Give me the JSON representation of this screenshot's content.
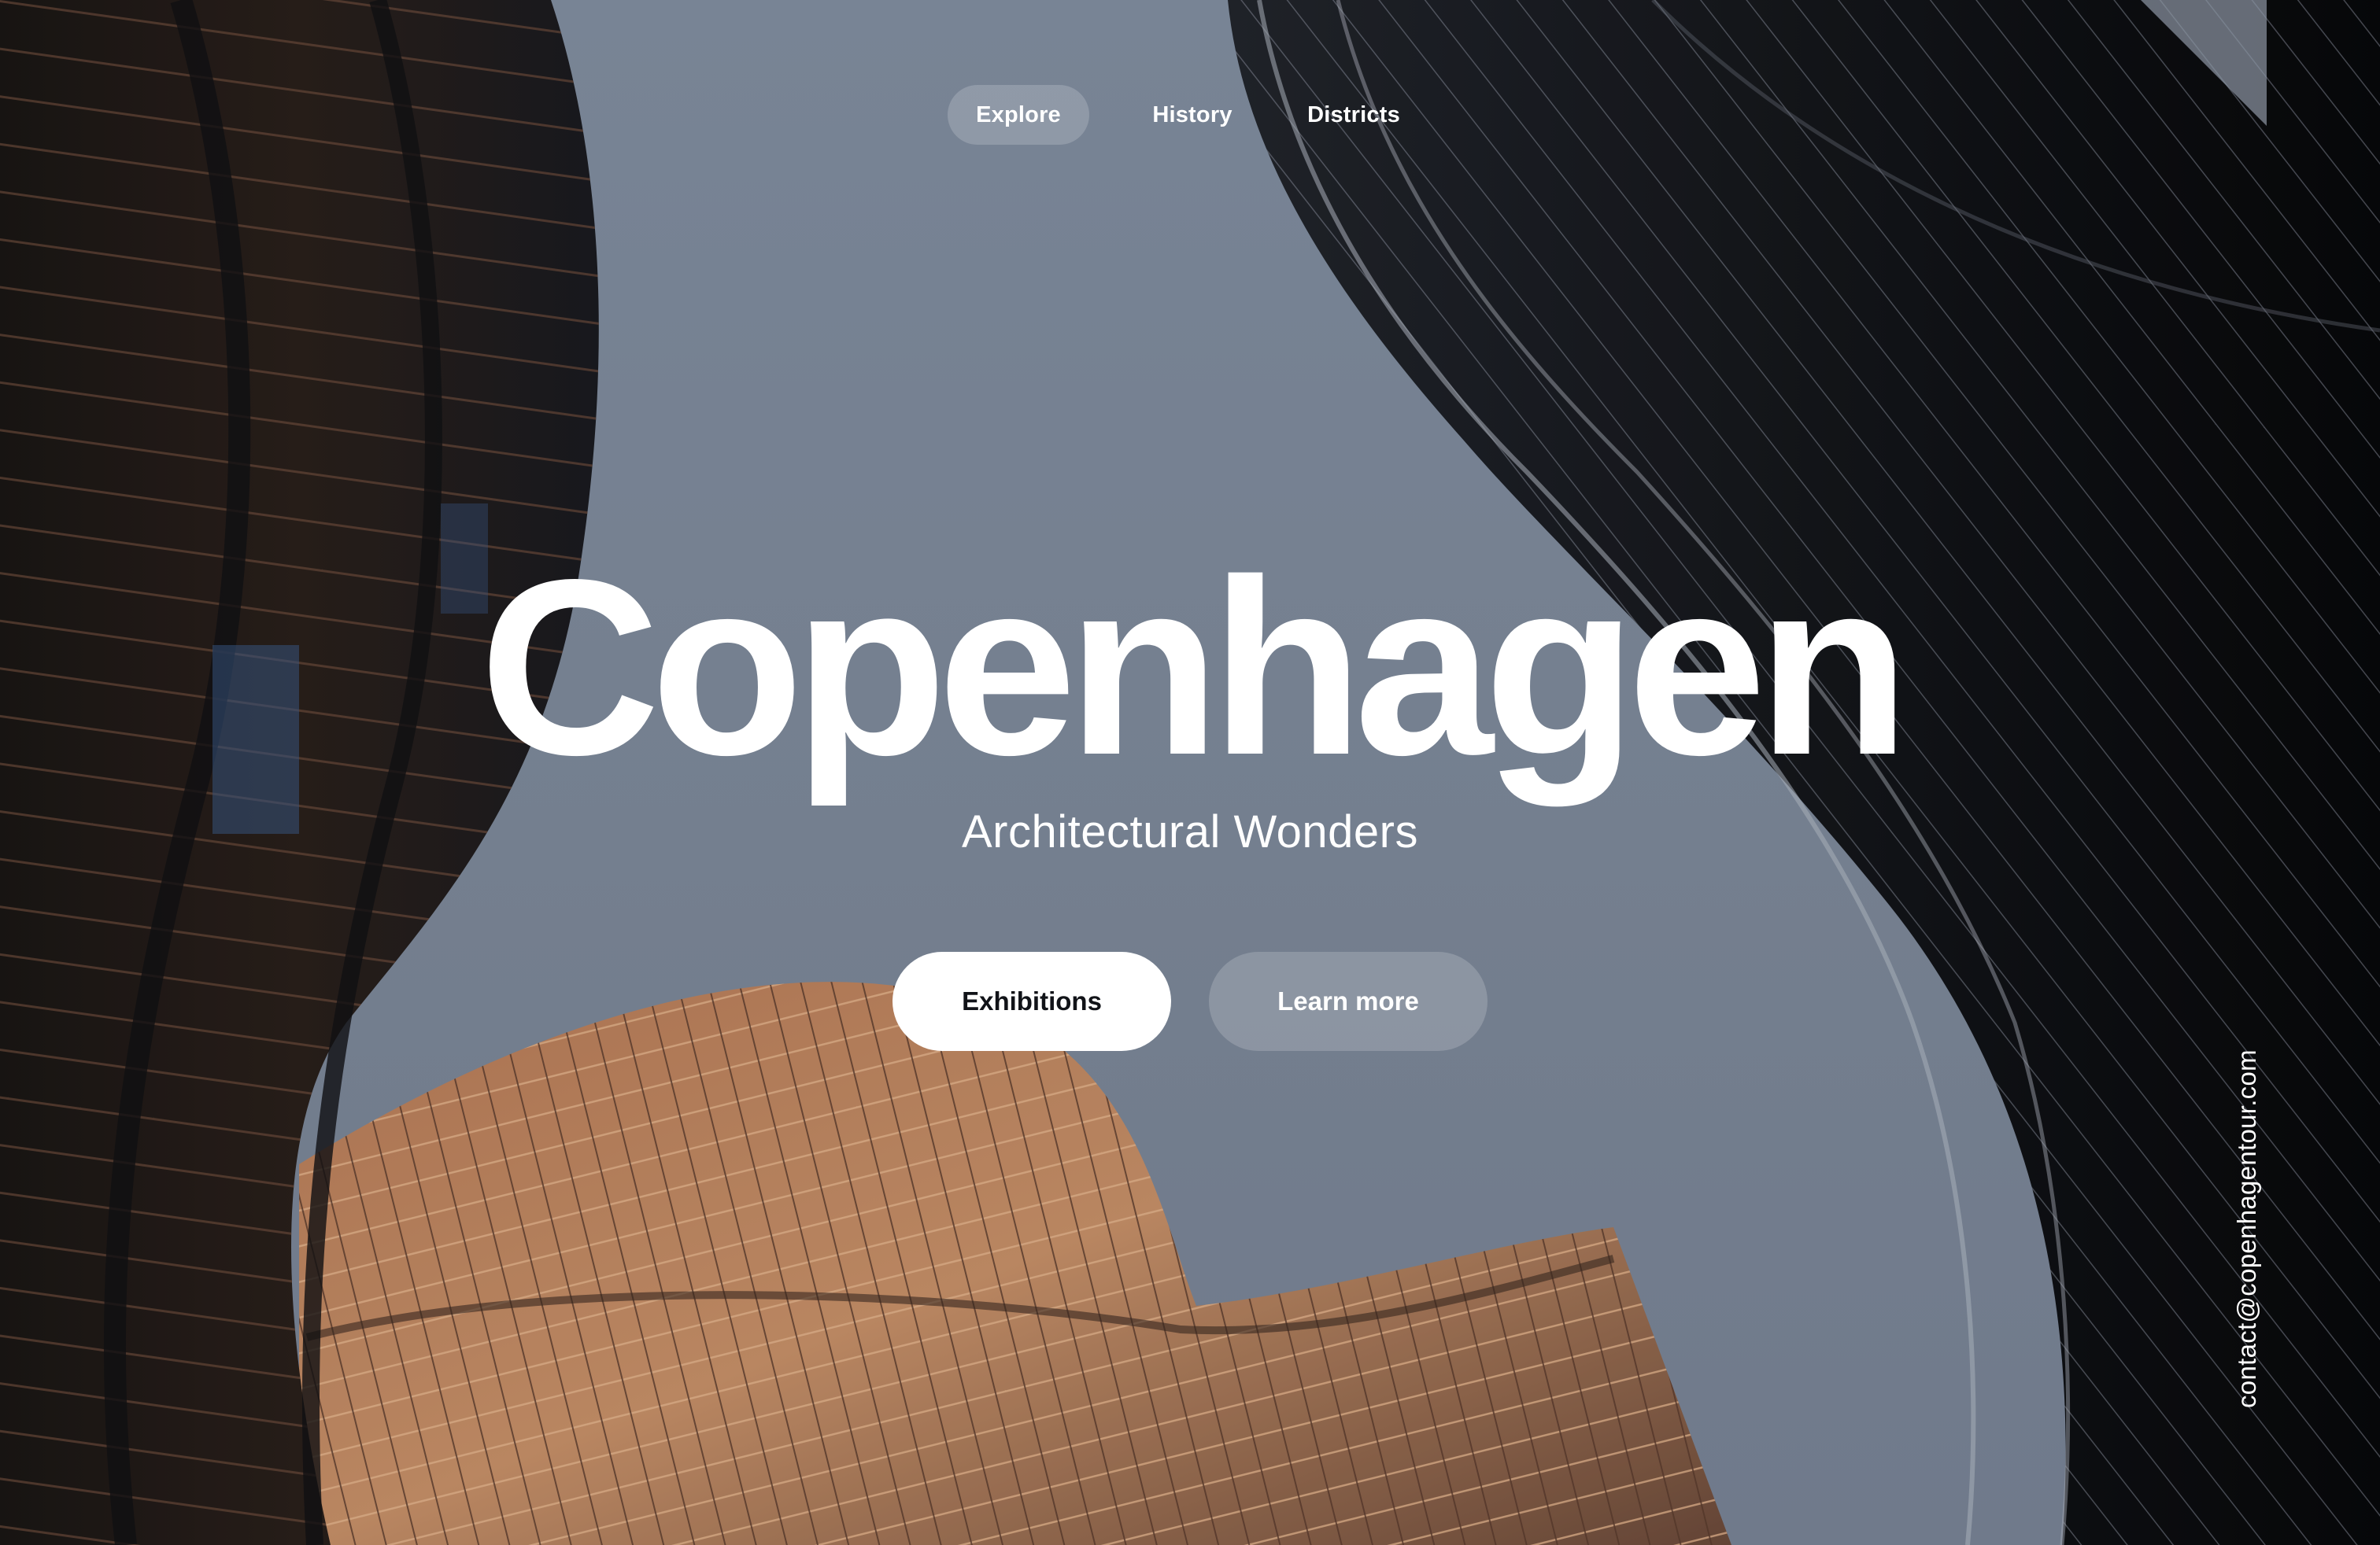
{
  "nav": {
    "items": [
      {
        "label": "Explore",
        "active": true
      },
      {
        "label": "History",
        "active": false
      },
      {
        "label": "Districts",
        "active": false
      }
    ]
  },
  "hero": {
    "title": "Copenhagen",
    "subtitle": "Architectural Wonders"
  },
  "actions": {
    "primary_label": "Exhibitions",
    "secondary_label": "Learn more"
  },
  "contact": {
    "email": "contact@copenhagentour.com"
  },
  "colors": {
    "sky": "#7f8a9c",
    "building_dark": "#16181d",
    "building_copper": "#a86e4e",
    "text": "#ffffff",
    "primary_button_bg": "#ffffff",
    "primary_button_text": "#111318"
  }
}
